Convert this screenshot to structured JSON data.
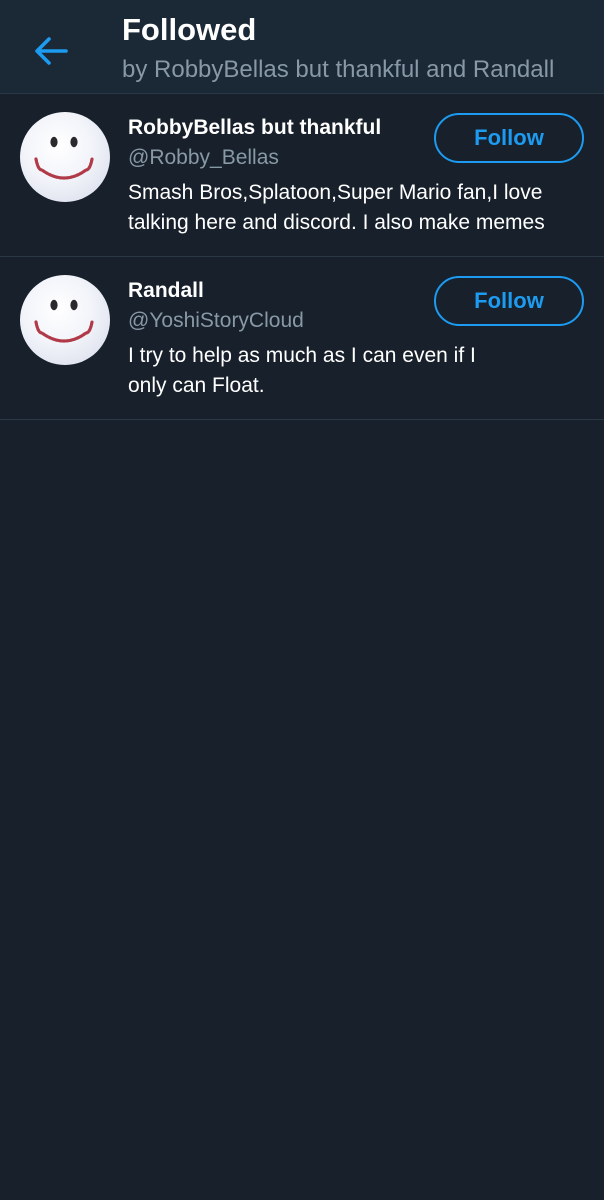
{
  "header": {
    "title": "Followed",
    "subtitle": "by RobbyBellas but thankful and Randall",
    "back_icon": "arrow-left-icon"
  },
  "colors": {
    "background": "#17202b",
    "header_background": "#1b2836",
    "accent": "#1d9bf0",
    "secondary_text": "#8899a6"
  },
  "users": [
    {
      "name": "RobbyBellas but thankful",
      "handle": "@Robby_Bellas",
      "bio": "Smash Bros,Splatoon,Super Mario fan,I love talking here and discord. I also make memes",
      "follow_label": "Follow",
      "avatar": "smiley-face-icon"
    },
    {
      "name": "Randall",
      "handle": "@YoshiStoryCloud",
      "bio": "I try to help as much as I can even if I only can Float.",
      "follow_label": "Follow",
      "avatar": "smiley-face-icon"
    }
  ]
}
